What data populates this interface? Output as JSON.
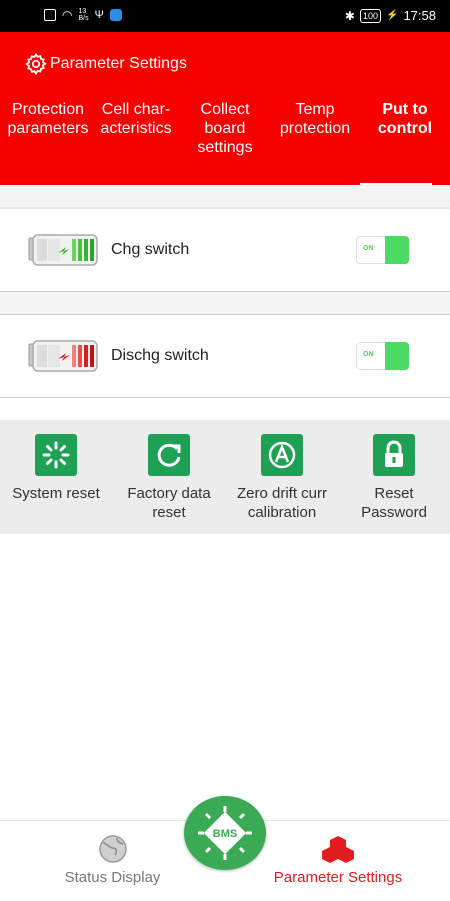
{
  "status_bar": {
    "left_small_top": "13",
    "left_small_bottom": "B/s",
    "battery": "100",
    "time": "17:58"
  },
  "header": {
    "title": "Parameter Settings",
    "tabs": [
      {
        "label_lines": [
          "Protection",
          "parameters"
        ]
      },
      {
        "label_lines": [
          "Cell char-",
          "acteristics"
        ]
      },
      {
        "label_lines": [
          "Collect",
          "board",
          "settings"
        ]
      },
      {
        "label_lines": [
          "Temp",
          "protection"
        ]
      },
      {
        "label_lines": [
          "Put to",
          "control"
        ],
        "active": true
      }
    ]
  },
  "switches": [
    {
      "label": "Chg switch",
      "state": "ON",
      "icon": "charging-battery-icon",
      "color": "#33b536"
    },
    {
      "label": "Dischg switch",
      "state": "ON",
      "icon": "discharging-battery-icon",
      "color": "#e21b1b"
    }
  ],
  "actions": [
    {
      "label_lines": [
        "System reset"
      ],
      "icon": "loading-spinner-icon"
    },
    {
      "label_lines": [
        "Factory data",
        "reset"
      ],
      "icon": "refresh-icon"
    },
    {
      "label_lines": [
        "Zero drift curr",
        "calibration"
      ],
      "icon": "letter-a-icon"
    },
    {
      "label_lines": [
        "Reset",
        "Password"
      ],
      "icon": "padlock-icon"
    }
  ],
  "bottom_nav": {
    "left_label": "Status Display",
    "right_label": "Parameter Settings",
    "center_badge": "BMS",
    "active_color": "#e11d1d",
    "inactive_color": "#777777"
  },
  "colors": {
    "header": "#f60000",
    "accent_green": "#1ea055",
    "toggle_green": "#4cd964"
  }
}
